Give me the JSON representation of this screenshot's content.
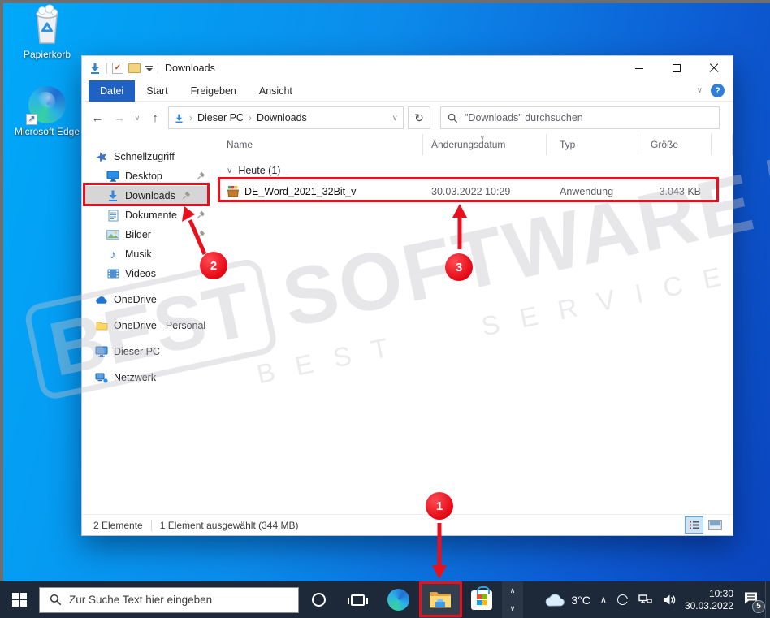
{
  "desktop": {
    "icons": [
      {
        "label": "Papierkorb"
      },
      {
        "label": "Microsoft Edge"
      }
    ]
  },
  "window": {
    "title": "Downloads",
    "tabs": [
      {
        "label": "Datei"
      },
      {
        "label": "Start"
      },
      {
        "label": "Freigeben"
      },
      {
        "label": "Ansicht"
      }
    ],
    "address": {
      "items": [
        "Dieser PC",
        "Downloads"
      ]
    },
    "search_placeholder": "\"Downloads\" durchsuchen",
    "sidebar": {
      "items": [
        {
          "label": "Schnellzugriff"
        },
        {
          "label": "Desktop"
        },
        {
          "label": "Downloads"
        },
        {
          "label": "Dokumente"
        },
        {
          "label": "Bilder"
        },
        {
          "label": "Musik"
        },
        {
          "label": "Videos"
        },
        {
          "label": "OneDrive"
        },
        {
          "label": "OneDrive - Personal"
        },
        {
          "label": "Dieser PC"
        },
        {
          "label": "Netzwerk"
        }
      ]
    },
    "columns": [
      {
        "label": "Name"
      },
      {
        "label": "Änderungsdatum"
      },
      {
        "label": "Typ"
      },
      {
        "label": "Größe"
      }
    ],
    "group_label": "Heute (1)",
    "files": [
      {
        "name": "DE_Word_2021_32Bit_v",
        "modified": "30.03.2022 10:29",
        "type": "Anwendung",
        "size": "3.043 KB"
      }
    ],
    "statusbar": {
      "count": "2 Elemente",
      "selection": "1 Element ausgewählt (344 MB)"
    },
    "help_label": "?"
  },
  "taskbar": {
    "search_placeholder": "Zur Suche Text hier eingeben",
    "weather_temp": "3°C",
    "clock": {
      "time": "10:30",
      "date": "30.03.2022"
    },
    "notification_count": "5"
  },
  "watermark": {
    "badge": "BEST",
    "word": "SOFTWARE",
    "line2": "BEST SERVICE"
  },
  "annotations": {
    "step1": "1",
    "step2": "2",
    "step3": "3"
  },
  "glyphs": {
    "back": "←",
    "forward": "→",
    "up": "↑",
    "refresh": "↻",
    "chevron_down": "∨",
    "chevron_up": "∧",
    "breadcrumb_sep": "›",
    "music_note": "♪",
    "check": "✓",
    "shortcut_arrow": "↗"
  },
  "colors": {
    "accent_red": "#e8101c",
    "datei_tab_blue": "#2062c4",
    "taskbar_bg": "#1d2939"
  }
}
